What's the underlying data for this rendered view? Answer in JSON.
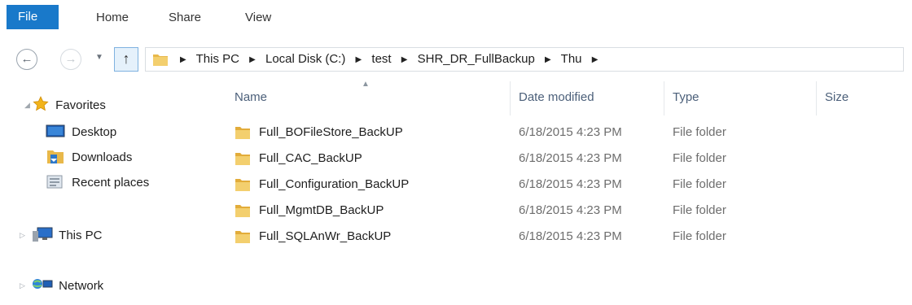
{
  "ribbon": {
    "tabs": [
      "File",
      "Home",
      "Share",
      "View"
    ]
  },
  "nav": {
    "back_icon": "back-arrow-icon",
    "forward_icon": "forward-arrow-icon",
    "up_icon": "up-arrow-icon",
    "breadcrumb": [
      "This PC",
      "Local Disk (C:)",
      "test",
      "SHR_DR_FullBackup",
      "Thu"
    ]
  },
  "sidebar": {
    "favorites": {
      "label": "Favorites",
      "icon": "star-icon"
    },
    "items": [
      {
        "label": "Desktop",
        "icon": "desktop-icon"
      },
      {
        "label": "Downloads",
        "icon": "downloads-folder-icon"
      },
      {
        "label": "Recent places",
        "icon": "recent-places-icon"
      }
    ],
    "this_pc": {
      "label": "This PC",
      "icon": "computer-icon"
    },
    "network": {
      "label": "Network",
      "icon": "network-icon"
    }
  },
  "columns": {
    "name": "Name",
    "date": "Date modified",
    "type": "Type",
    "size": "Size"
  },
  "files": [
    {
      "name": "Full_BOFileStore_BackUP",
      "date": "6/18/2015 4:23 PM",
      "type": "File folder"
    },
    {
      "name": "Full_CAC_BackUP",
      "date": "6/18/2015 4:23 PM",
      "type": "File folder"
    },
    {
      "name": "Full_Configuration_BackUP",
      "date": "6/18/2015 4:23 PM",
      "type": "File folder"
    },
    {
      "name": "Full_MgmtDB_BackUP",
      "date": "6/18/2015 4:23 PM",
      "type": "File folder"
    },
    {
      "name": "Full_SQLAnWr_BackUP",
      "date": "6/18/2015 4:23 PM",
      "type": "File folder"
    }
  ],
  "colors": {
    "accent": "#1979ca",
    "folder": "#e8b84a",
    "header_text": "#4c607a"
  }
}
